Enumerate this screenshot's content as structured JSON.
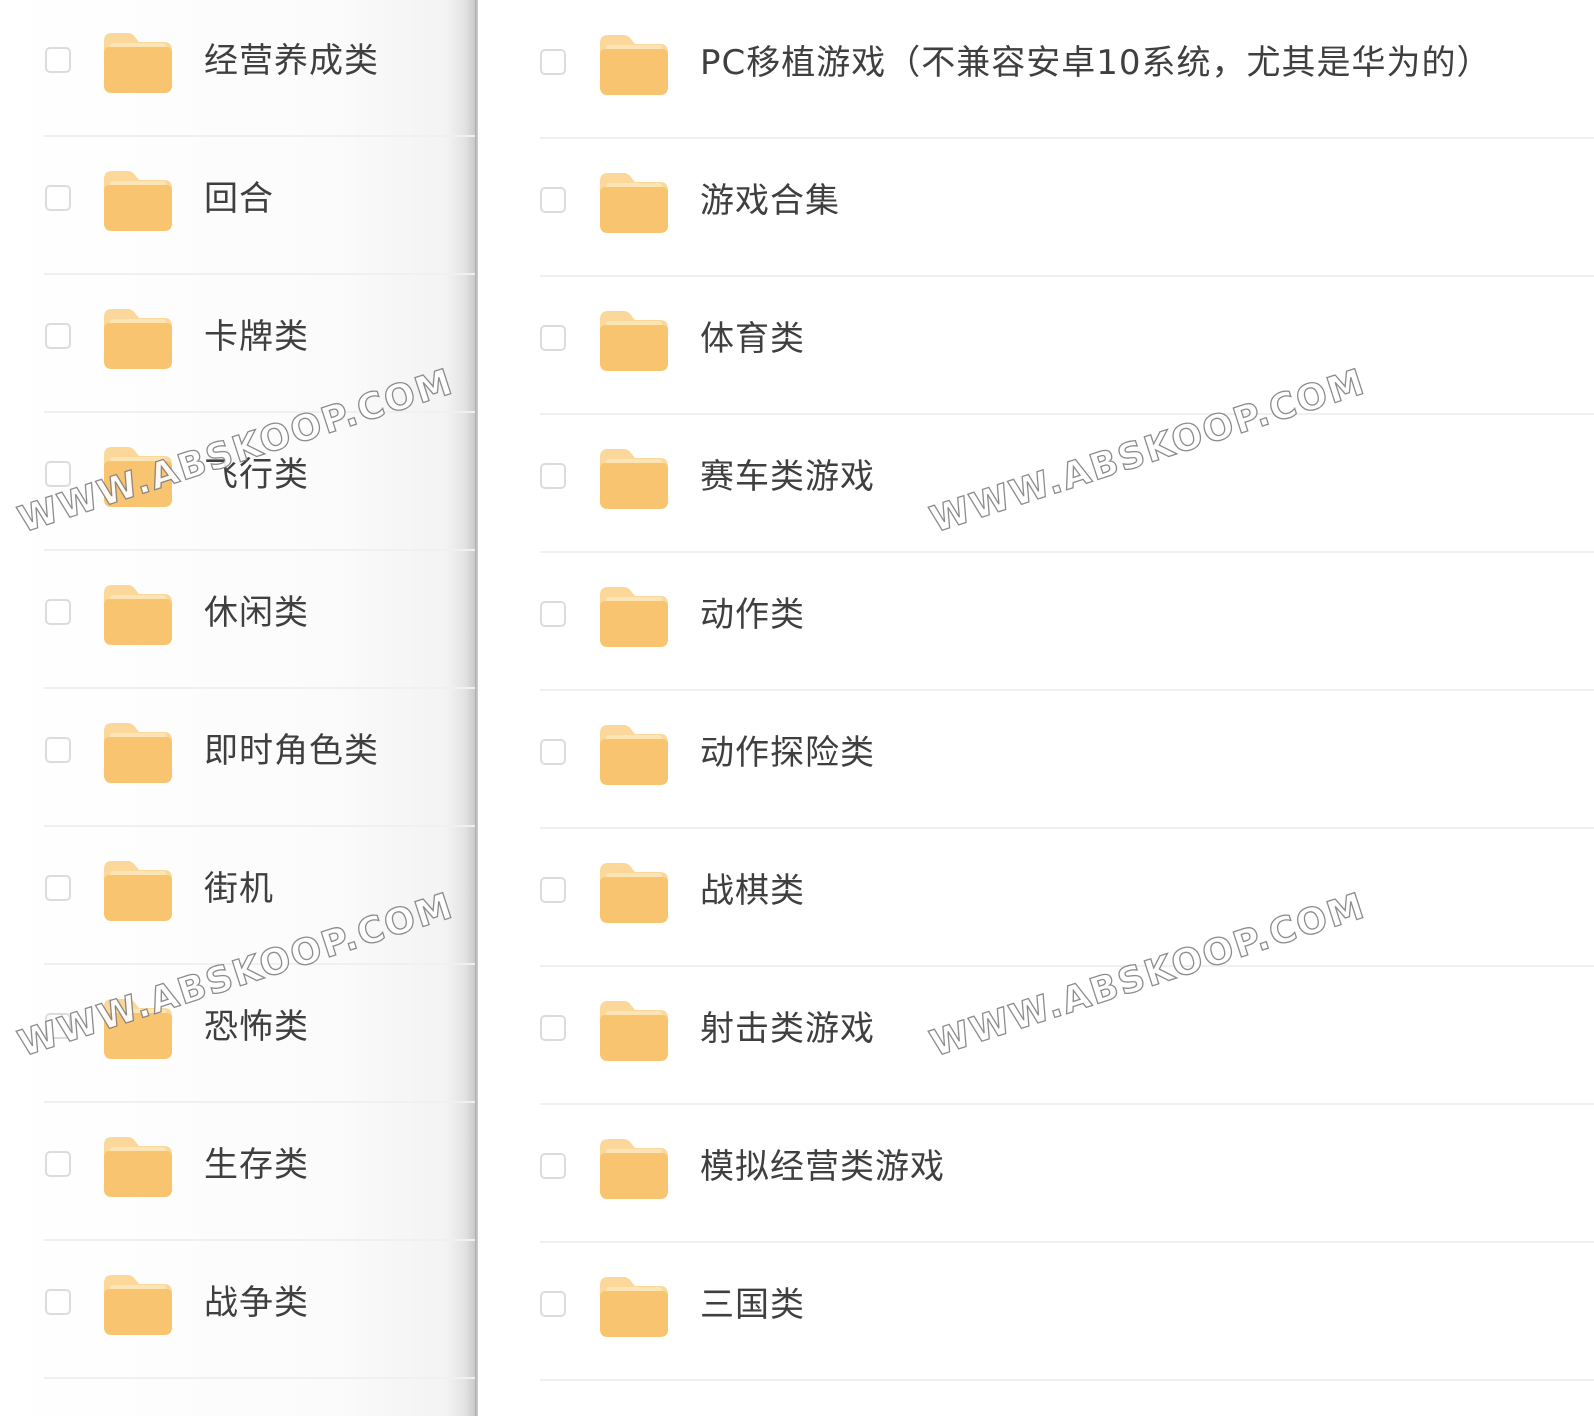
{
  "watermark_text": "WWW.ABSKOOP.COM",
  "left_folders": [
    {
      "name": "经营养成类"
    },
    {
      "name": "回合"
    },
    {
      "name": "卡牌类"
    },
    {
      "name": "飞行类"
    },
    {
      "name": "休闲类"
    },
    {
      "name": "即时角色类"
    },
    {
      "name": "街机"
    },
    {
      "name": "恐怖类"
    },
    {
      "name": "生存类"
    },
    {
      "name": "战争类"
    }
  ],
  "right_folders": [
    {
      "name": "PC移植游戏（不兼容安卓10系统，尤其是华为的）"
    },
    {
      "name": "游戏合集"
    },
    {
      "name": "体育类"
    },
    {
      "name": "赛车类游戏"
    },
    {
      "name": "动作类"
    },
    {
      "name": "动作探险类"
    },
    {
      "name": "战棋类"
    },
    {
      "name": "射击类游戏"
    },
    {
      "name": "模拟经营类游戏"
    },
    {
      "name": "三国类"
    }
  ],
  "colors": {
    "folder_fill": "#f9c46f",
    "folder_highlight": "#fde4b4",
    "folder_tab": "#fbd79a",
    "text": "#3f3f3f",
    "checkbox_border": "#dcdcdc",
    "divider": "#f0f0f0",
    "pane_separator": "#a9a9a9"
  }
}
